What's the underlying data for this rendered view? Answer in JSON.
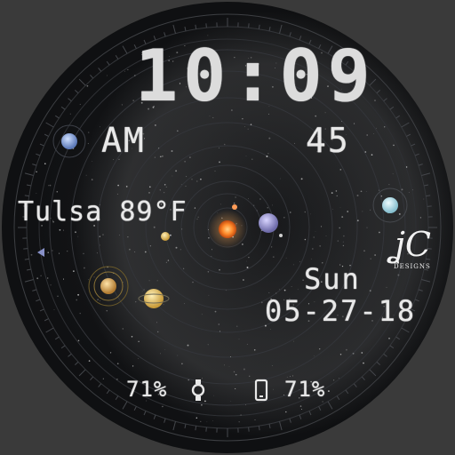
{
  "watch_face": {
    "time": "10:09",
    "am_pm": "AM",
    "seconds": "45",
    "location_weather": "Tulsa 89°F",
    "day": "Sun",
    "date": "05-27-18",
    "watch_battery": "71%",
    "phone_battery": "71%",
    "logo_text": "DESIGNS"
  },
  "icons": {
    "watch_battery": "watch-icon",
    "phone_battery": "phone-icon",
    "pointer": "triangle-pointer-icon"
  },
  "colors": {
    "background": "#101113",
    "text": "#e8e8e8",
    "sun": "#ff8a2a",
    "ring": "#3a3c40"
  }
}
